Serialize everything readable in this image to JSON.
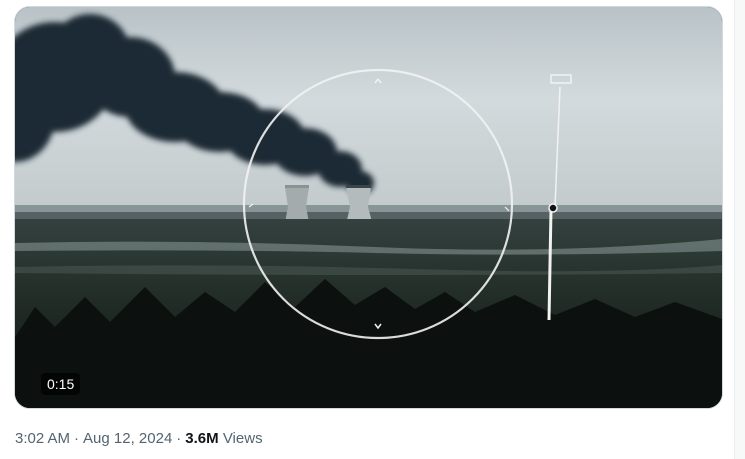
{
  "video": {
    "duration": "0:15",
    "accent_colors": {
      "sky": "#c9d2d6",
      "smoke": "#1e2a33",
      "forest": "#1a2220",
      "fire": "#ff7a30",
      "reticle": "#f2f2f2"
    }
  },
  "meta": {
    "time": "3:02 AM",
    "separator": "·",
    "date": "Aug 12, 2024",
    "views_count": "3.6M",
    "views_label": "Views"
  }
}
